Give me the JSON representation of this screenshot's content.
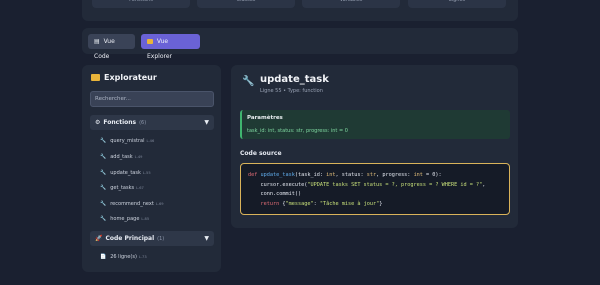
{
  "top": {
    "stats": [
      "Fonctions",
      "Classes",
      "Variables",
      "Lignes"
    ]
  },
  "view_toggle": {
    "code_label": "Vue Code",
    "explorer_label": "Vue Explorer"
  },
  "sidebar": {
    "title": "Explorateur",
    "search_placeholder": "Rechercher...",
    "functions_group": {
      "label": "Fonctions",
      "count": "(6)",
      "items": [
        {
          "name": "query_mistral",
          "line": "L.46"
        },
        {
          "name": "add_task",
          "line": "L.49"
        },
        {
          "name": "update_task",
          "line": "L.55"
        },
        {
          "name": "get_tasks",
          "line": "L.67"
        },
        {
          "name": "recommend_next",
          "line": "L.69"
        },
        {
          "name": "home_page",
          "line": "L.85"
        }
      ]
    },
    "principal_group": {
      "label": "Code Principal",
      "count": "(1)",
      "items": [
        {
          "name": "26 ligne(s)",
          "line": "L.73"
        }
      ]
    }
  },
  "detail": {
    "title": "update_task",
    "subtitle": "Ligne 55 • Type: function",
    "params_title": "Paramètres",
    "params_text": "task_id: int, status: str, progress: int = 0",
    "code_label": "Code source"
  },
  "icons": {
    "code_button": "file-icon",
    "explorer_button": "folder-icon",
    "functions": "gear-icon",
    "principal": "rocket-icon",
    "item": "wrench-icon",
    "principal_item": "document-icon"
  },
  "colors": {
    "accent": "#6a62d6",
    "params_bg": "#1f3a34",
    "code_border": "#d9b35a"
  }
}
